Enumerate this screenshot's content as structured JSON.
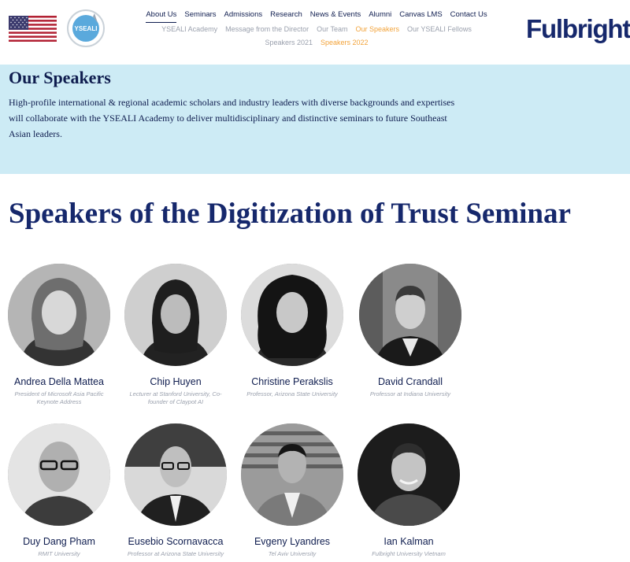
{
  "header": {
    "brand": "Fulbright",
    "nav_primary": [
      "About Us",
      "Seminars",
      "Admissions",
      "Research",
      "News & Events",
      "Alumni",
      "Canvas LMS",
      "Contact Us"
    ],
    "nav_secondary": [
      "YSEALI Academy",
      "Message from the Director",
      "Our Team",
      "Our Speakers",
      "Our YSEALI Fellows"
    ],
    "nav_tertiary": [
      "Speakers 2021",
      "Speakers 2022"
    ],
    "logo_text": "YSEALI"
  },
  "intro": {
    "title": "Our Speakers",
    "text": "High-profile international & regional academic scholars and industry leaders with diverse backgrounds and expertises will collaborate with the YSEALI Academy to deliver multidisciplinary and distinctive seminars to future Southeast Asian leaders."
  },
  "section": {
    "title": "Speakers of the Digitization of Trust Seminar"
  },
  "speakers": [
    {
      "name": "Andrea Della Mattea",
      "title": "President of Microsoft Asia Pacific Keynote Address"
    },
    {
      "name": "Chip Huyen",
      "title": "Lecturer at Stanford University, Co-founder of Claypot AI"
    },
    {
      "name": "Christine Perakslis",
      "title": "Professor, Arizona State University"
    },
    {
      "name": "David Crandall",
      "title": "Professor at Indiana University"
    },
    {
      "name": "Duy Dang Pham",
      "title": "RMIT University"
    },
    {
      "name": "Eusebio Scornavacca",
      "title": "Professor at Arizona State University"
    },
    {
      "name": "Evgeny Lyandres",
      "title": "Tel Aviv University"
    },
    {
      "name": "Ian Kalman",
      "title": "Fulbright University Vietnam"
    }
  ],
  "colors": {
    "navy": "#0f1d4f",
    "band": "#cdebf5",
    "accent": "#f2a33a",
    "muted": "#9aa0ad"
  }
}
